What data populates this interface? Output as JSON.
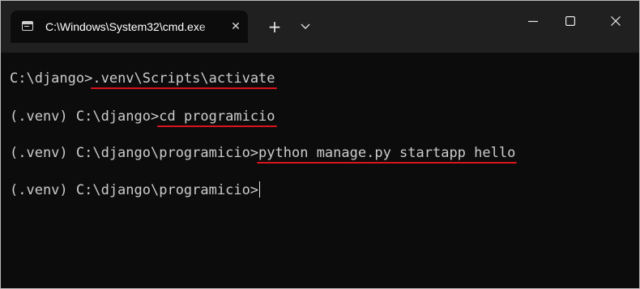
{
  "window": {
    "tab_title": "C:\\Windows\\System32\\cmd.exe"
  },
  "icons": {
    "tab": "terminal-app-icon",
    "tab_close": "close-icon",
    "new_tab": "plus-icon",
    "dropdown": "chevron-down-icon",
    "minimize": "minimize-icon",
    "maximize": "maximize-icon",
    "close": "close-icon"
  },
  "colors": {
    "background": "#0c0c0c",
    "titlebar": "#202020",
    "text": "#cccccc",
    "underline": "#d8141c"
  },
  "terminal": {
    "lines": [
      {
        "prompt": "C:\\django>",
        "command": ".venv\\Scripts\\activate"
      },
      {
        "prompt": "(.venv) C:\\django>",
        "command": "cd programicio"
      },
      {
        "prompt": "(.venv) C:\\django\\programicio>",
        "command": "python manage.py startapp hello"
      },
      {
        "prompt": "(.venv) C:\\django\\programicio>",
        "command": ""
      }
    ]
  }
}
